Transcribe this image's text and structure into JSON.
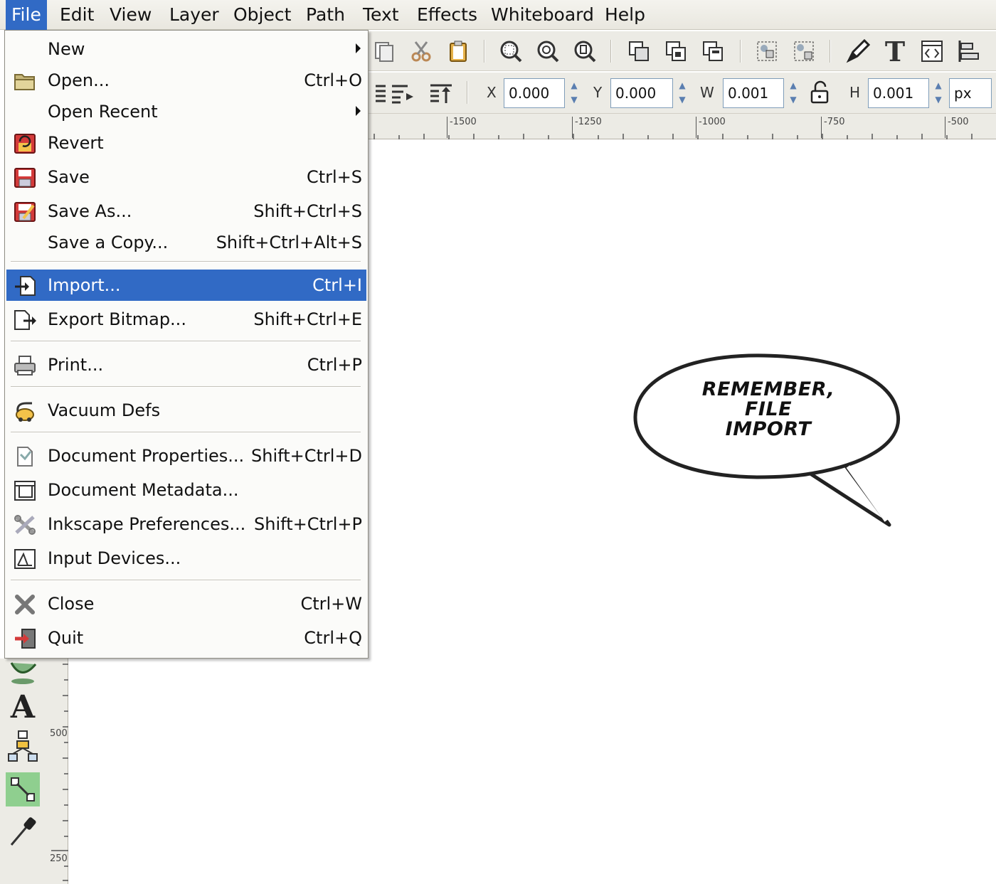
{
  "menubar": {
    "items": [
      "File",
      "Edit",
      "View",
      "Layer",
      "Object",
      "Path",
      "Text",
      "Effects",
      "Whiteboard",
      "Help"
    ]
  },
  "controls": {
    "x_label": "X",
    "x_value": "0.000",
    "y_label": "Y",
    "y_value": "0.000",
    "w_label": "W",
    "w_value": "0.001",
    "h_label": "H",
    "h_value": "0.001",
    "unit": "px"
  },
  "hruler": {
    "labels": [
      "-1500",
      "-1250",
      "-1000",
      "-750",
      "-500"
    ]
  },
  "vruler": {
    "labels": [
      "500",
      "250"
    ]
  },
  "file_menu": {
    "items": [
      {
        "label": "New",
        "shortcut": "",
        "submenu": true,
        "icon": "new-icon"
      },
      {
        "label": "Open...",
        "shortcut": "Ctrl+O",
        "icon": "folder-open-icon"
      },
      {
        "label": "Open Recent",
        "shortcut": "",
        "submenu": true,
        "icon": "recent-icon"
      },
      {
        "label": "Revert",
        "shortcut": "",
        "icon": "revert-icon"
      },
      {
        "label": "Save",
        "shortcut": "Ctrl+S",
        "icon": "save-icon"
      },
      {
        "label": "Save As...",
        "shortcut": "Shift+Ctrl+S",
        "icon": "save-as-icon"
      },
      {
        "label": "Save a Copy...",
        "shortcut": "Shift+Ctrl+Alt+S",
        "icon": "save-copy-icon"
      },
      {
        "label": "Import...",
        "shortcut": "Ctrl+I",
        "icon": "import-icon"
      },
      {
        "label": "Export Bitmap...",
        "shortcut": "Shift+Ctrl+E",
        "icon": "export-icon"
      },
      {
        "label": "Print...",
        "shortcut": "Ctrl+P",
        "icon": "printer-icon"
      },
      {
        "label": "Vacuum Defs",
        "shortcut": "",
        "icon": "vacuum-icon"
      },
      {
        "label": "Document Properties...",
        "shortcut": "Shift+Ctrl+D",
        "icon": "document-properties-icon"
      },
      {
        "label": "Document Metadata...",
        "shortcut": "",
        "icon": "document-metadata-icon"
      },
      {
        "label": "Inkscape Preferences...",
        "shortcut": "Shift+Ctrl+P",
        "icon": "preferences-icon"
      },
      {
        "label": "Input Devices...",
        "shortcut": "",
        "icon": "input-devices-icon"
      },
      {
        "label": "Close",
        "shortcut": "Ctrl+W",
        "icon": "close-icon"
      },
      {
        "label": "Quit",
        "shortcut": "Ctrl+Q",
        "icon": "quit-icon"
      }
    ]
  },
  "bubble": {
    "lines": [
      "REMEMBER,",
      "FILE",
      "IMPORT"
    ]
  },
  "colors": {
    "highlight": "#316ac5",
    "toolbar_bg": "#ecebe5",
    "menu_bg": "#fbfbf9"
  }
}
